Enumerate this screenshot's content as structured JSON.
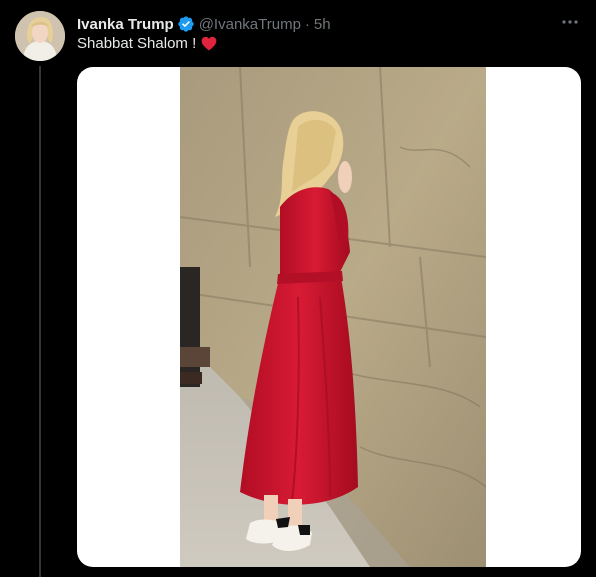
{
  "tweet": {
    "author_name": "Ivanka Trump",
    "handle": "@IvankaTrump",
    "separator": "·",
    "time": "5h",
    "text": "Shabbat Shalom !"
  },
  "icons": {
    "verified": "verified-badge-icon",
    "more": "more-options-icon",
    "heart": "red-heart-emoji"
  },
  "colors": {
    "background": "#000000",
    "text": "#e7e9ea",
    "secondary": "#71767b",
    "verified": "#1d9bf0",
    "heart": "#e0243e",
    "dress": "#c8102e",
    "stone": "#b7a786"
  }
}
